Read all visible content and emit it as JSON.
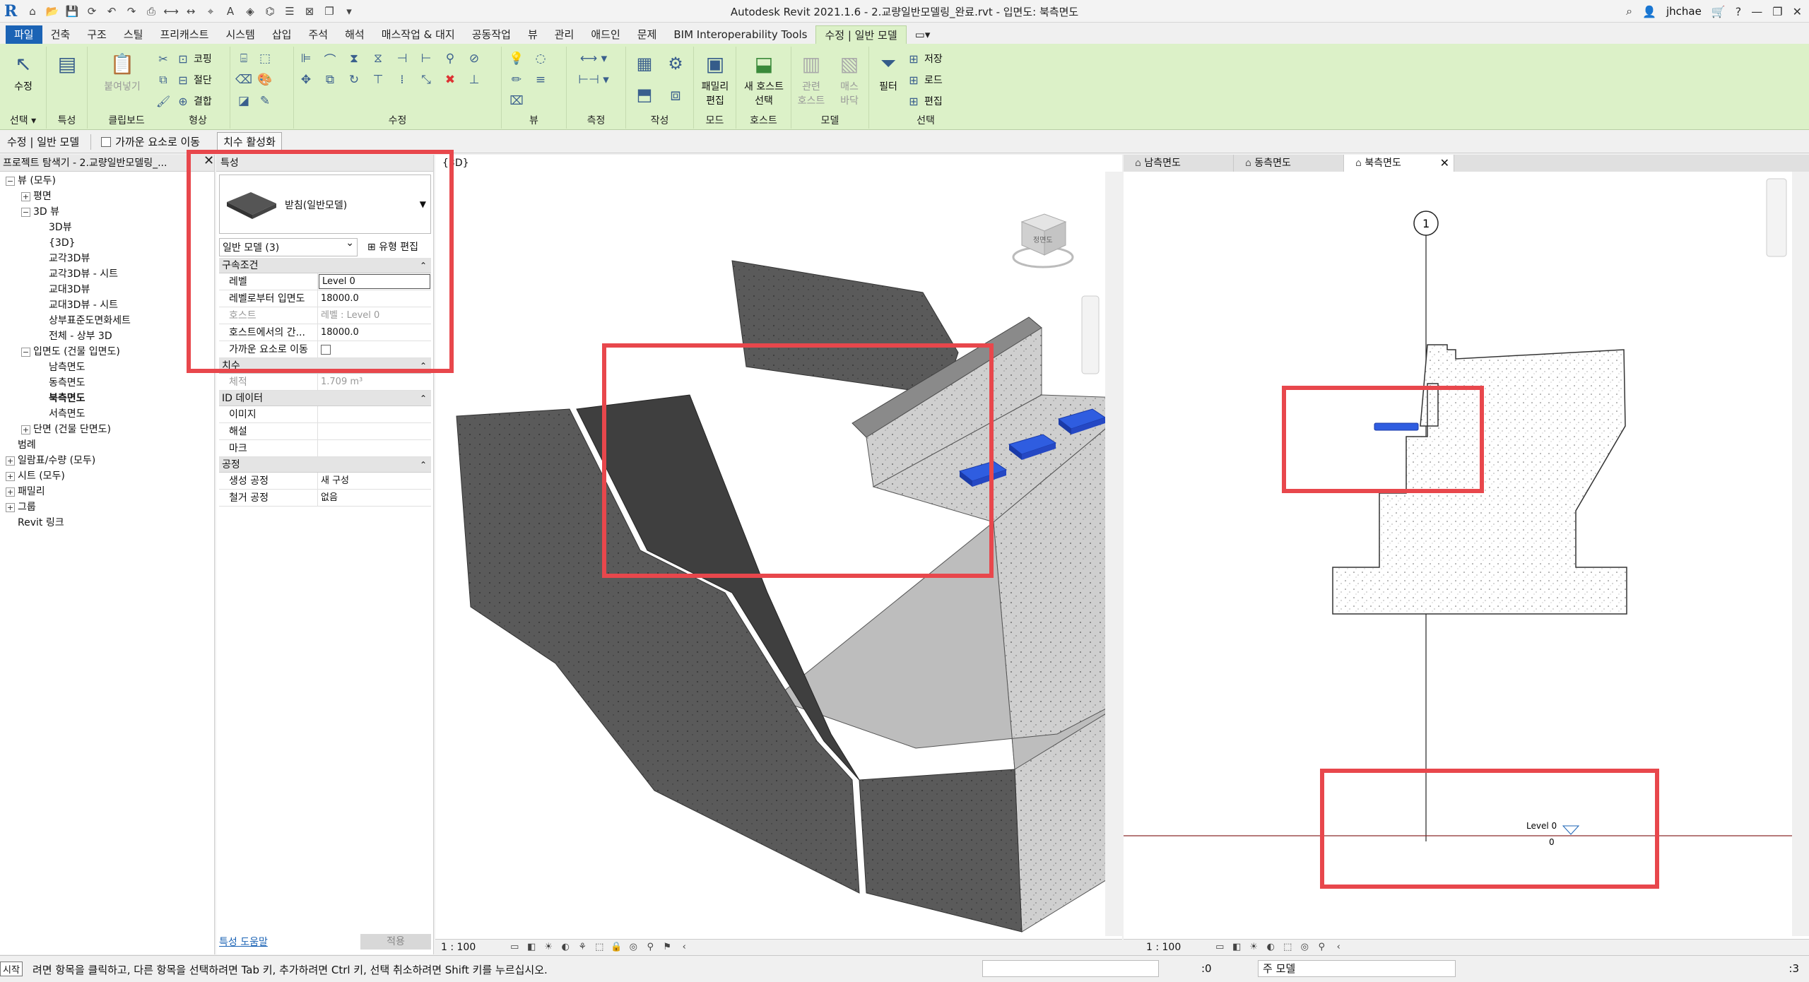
{
  "window": {
    "title": "Autodesk Revit 2021.1.6 - 2.교량일반모델링_완료.rvt - 입면도: 북측면도",
    "user": "jhchae"
  },
  "ribbon_tabs": [
    "파일",
    "건축",
    "구조",
    "스틸",
    "프리캐스트",
    "시스템",
    "삽입",
    "주석",
    "해석",
    "매스작업 & 대지",
    "공동작업",
    "뷰",
    "관리",
    "애드인",
    "문제",
    "BIM Interoperability Tools",
    "수정 | 일반 모델"
  ],
  "ribbon": {
    "modify": "수정",
    "select": "선택",
    "properties": "특성",
    "paste": "붙여넣기",
    "clipboard": "클립보드",
    "cope": "코핑",
    "cut": "절단",
    "join": "결합",
    "geometry": "형상",
    "modify_group": "수정",
    "view_group": "뷰",
    "measure": "측정",
    "create": "작성",
    "edit_family_1": "패밀리",
    "edit_family_2": "편집",
    "mode": "모드",
    "new_host_1": "새 호스트",
    "new_host_2": "선택",
    "host": "호스트",
    "rel_host_1": "관련",
    "rel_host_2": "호스트",
    "mass_floor_1": "매스",
    "mass_floor_2": "바닥",
    "model": "모델",
    "filter": "필터",
    "sel_save": "저장",
    "sel_load": "로드",
    "sel_edit": "편집",
    "selection": "선택"
  },
  "optbar": {
    "mode": "수정 | 일반 모델",
    "snap_label": "가까운 요소로 이동",
    "activate_dims": "치수 활성화"
  },
  "browser": {
    "header": "프로젝트 탐색기 - 2.교량일반모델링_...",
    "items": [
      {
        "label": "뷰 (모두)",
        "level": 0,
        "tw": "⊟"
      },
      {
        "label": "평면",
        "level": 1,
        "tw": "⊞"
      },
      {
        "label": "3D 뷰",
        "level": 1,
        "tw": "⊟"
      },
      {
        "label": "3D뷰",
        "level": 2,
        "tw": ""
      },
      {
        "label": "{3D}",
        "level": 2,
        "tw": ""
      },
      {
        "label": "교각3D뷰",
        "level": 2,
        "tw": ""
      },
      {
        "label": "교각3D뷰 - 시트",
        "level": 2,
        "tw": ""
      },
      {
        "label": "교대3D뷰",
        "level": 2,
        "tw": ""
      },
      {
        "label": "교대3D뷰 - 시트",
        "level": 2,
        "tw": ""
      },
      {
        "label": "상부표준도면화세트",
        "level": 2,
        "tw": ""
      },
      {
        "label": "전체 - 상부 3D",
        "level": 2,
        "tw": ""
      },
      {
        "label": "입면도 (건물 입면도)",
        "level": 1,
        "tw": "⊟"
      },
      {
        "label": "남측면도",
        "level": 2,
        "tw": ""
      },
      {
        "label": "동측면도",
        "level": 2,
        "tw": ""
      },
      {
        "label": "북측면도",
        "level": 2,
        "tw": "",
        "selected": true
      },
      {
        "label": "서측면도",
        "level": 2,
        "tw": ""
      },
      {
        "label": "단면 (건물 단면도)",
        "level": 1,
        "tw": "⊞"
      },
      {
        "label": "범례",
        "level": 0,
        "tw": ""
      },
      {
        "label": "일람표/수량 (모두)",
        "level": 0,
        "tw": "⊞"
      },
      {
        "label": "시트 (모두)",
        "level": 0,
        "tw": "⊞"
      },
      {
        "label": "패밀리",
        "level": 0,
        "tw": "⊞"
      },
      {
        "label": "그룹",
        "level": 0,
        "tw": "⊞"
      },
      {
        "label": "Revit 링크",
        "level": 0,
        "tw": ""
      }
    ]
  },
  "properties": {
    "header": "특성",
    "type_name": "받침(일반모델)",
    "instance_selector": "일반 모델 (3)",
    "edit_type": "유형 편집",
    "sections": [
      {
        "title": "구속조건",
        "rows": [
          {
            "k": "레벨",
            "v": "Level 0",
            "boxed": true
          },
          {
            "k": "레벨로부터 입면도",
            "v": "18000.0"
          },
          {
            "k": "호스트",
            "v": "레벨 : Level 0",
            "disabled": true
          },
          {
            "k": "호스트에서의 간...",
            "v": "18000.0"
          },
          {
            "k": "가까운 요소로 이동",
            "v": "",
            "checkbox": true
          }
        ]
      },
      {
        "title": "치수",
        "rows": [
          {
            "k": "체적",
            "v": "1.709 m³",
            "disabled": true
          }
        ]
      },
      {
        "title": "ID 데이터",
        "rows": [
          {
            "k": "이미지",
            "v": ""
          },
          {
            "k": "해설",
            "v": ""
          },
          {
            "k": "마크",
            "v": ""
          }
        ]
      },
      {
        "title": "공정",
        "rows": [
          {
            "k": "생성 공정",
            "v": "새 구성"
          },
          {
            "k": "철거 공정",
            "v": "없음"
          }
        ]
      }
    ],
    "help_link": "특성 도움말",
    "apply": "적용"
  },
  "view3d": {
    "tab": "{3D}",
    "scale": "1 : 100",
    "cube_label": "정면도"
  },
  "elevation": {
    "tabs": [
      "남측면도",
      "동측면도",
      "북측면도"
    ],
    "active_tab": "북측면도",
    "grid_label": "1",
    "level_name": "Level 0",
    "level_value": "0",
    "scale": "1 : 100"
  },
  "status": {
    "start": "시작",
    "message": "려면 항목을 클릭하고, 다른 항목을 선택하려면 Tab 키, 추가하려면 Ctrl 키, 선택 취소하려면 Shift 키를 누르십시오.",
    "zero": ":0",
    "model": "주 모델",
    "filter_count": ":3"
  },
  "colors": {
    "ribbon_bg": "#dcf1c8",
    "file_tab": "#1b63b5",
    "highlight": "#e8474c",
    "bearing": "#2f5de0"
  }
}
